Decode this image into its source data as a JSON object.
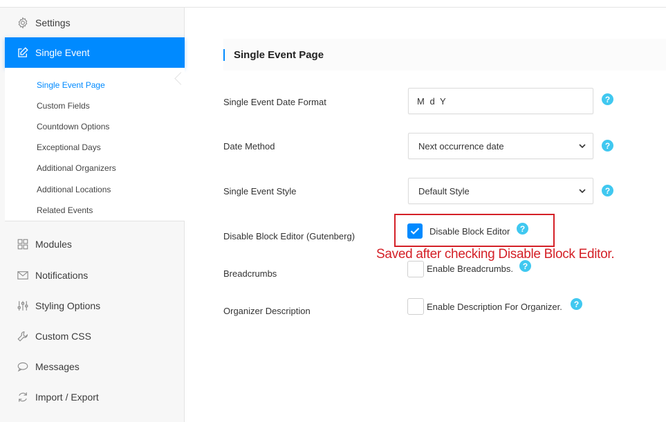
{
  "sidebar": {
    "items_top": [
      {
        "label": "Settings",
        "icon": "gear-icon",
        "active": false
      },
      {
        "label": "Single Event",
        "icon": "edit-icon",
        "active": true
      }
    ],
    "sub_items": [
      {
        "label": "Single Event Page",
        "active": true
      },
      {
        "label": "Custom Fields",
        "active": false
      },
      {
        "label": "Countdown Options",
        "active": false
      },
      {
        "label": "Exceptional Days",
        "active": false
      },
      {
        "label": "Additional Organizers",
        "active": false
      },
      {
        "label": "Additional Locations",
        "active": false
      },
      {
        "label": "Related Events",
        "active": false
      }
    ],
    "items_bottom": [
      {
        "label": "Modules",
        "icon": "grid-icon"
      },
      {
        "label": "Notifications",
        "icon": "envelope-icon"
      },
      {
        "label": "Styling Options",
        "icon": "sliders-icon"
      },
      {
        "label": "Custom CSS",
        "icon": "wrench-icon"
      },
      {
        "label": "Messages",
        "icon": "speech-bubble-icon"
      },
      {
        "label": "Import / Export",
        "icon": "refresh-icon"
      }
    ]
  },
  "main": {
    "section_title": "Single Event Page",
    "rows": {
      "date_format": {
        "label": "Single Event Date Format",
        "value": "M d Y",
        "help": "?"
      },
      "date_method": {
        "label": "Date Method",
        "value": "Next occurrence date",
        "help": "?"
      },
      "event_style": {
        "label": "Single Event Style",
        "value": "Default Style",
        "help": "?"
      },
      "block_editor": {
        "label": "Disable Block Editor (Gutenberg)",
        "checkbox_label": "Disable Block Editor",
        "checked": true,
        "help": "?"
      },
      "breadcrumbs": {
        "label": "Breadcrumbs",
        "checkbox_label": "Enable Breadcrumbs.",
        "checked": false,
        "help": "?"
      },
      "organizer_desc": {
        "label": "Organizer Description",
        "checkbox_label": "Enable Description For Organizer.",
        "checked": false,
        "help": "?"
      }
    }
  },
  "annotation": {
    "text": "Saved after checking Disable Block Editor.",
    "color": "#d42027"
  },
  "colors": {
    "accent": "#008aff",
    "help": "#40c8f0"
  }
}
